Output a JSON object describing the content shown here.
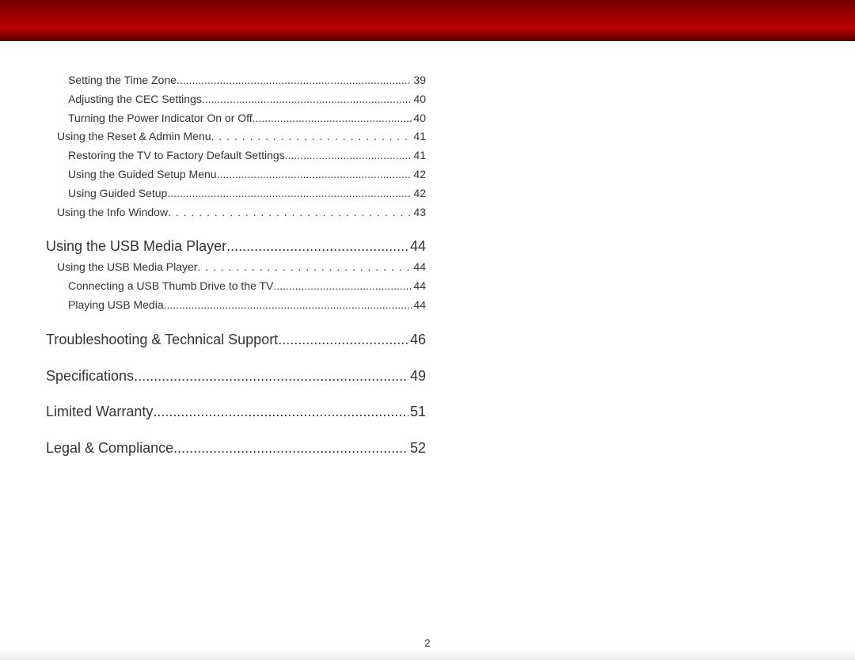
{
  "pageNumber": "2",
  "toc": [
    {
      "level": 2,
      "title": "Setting the Time Zone",
      "page": "39",
      "leader": "tight"
    },
    {
      "level": 2,
      "title": "Adjusting the CEC Settings",
      "page": "40",
      "leader": "tight"
    },
    {
      "level": 2,
      "title": "Turning the Power Indicator On or Off",
      "page": "40",
      "leader": "tight"
    },
    {
      "level": 1,
      "title": "Using the Reset & Admin Menu",
      "page": "41",
      "leader": "wide"
    },
    {
      "level": 2,
      "title": "Restoring the TV to Factory Default Settings",
      "page": "41",
      "leader": "tight"
    },
    {
      "level": 2,
      "title": "Using the Guided Setup Menu",
      "page": "42",
      "leader": "tight"
    },
    {
      "level": 2,
      "title": "Using Guided Setup",
      "page": "42",
      "leader": "tight"
    },
    {
      "level": 1,
      "title": "Using the Info Window",
      "page": "43",
      "leader": "wide"
    },
    {
      "level": 0,
      "title": "Using the USB Media Player",
      "page": "44",
      "leader": "tight"
    },
    {
      "level": 1,
      "title": "Using the USB Media Player",
      "page": "44",
      "leader": "wide"
    },
    {
      "level": 2,
      "title": "Connecting a USB Thumb Drive to the TV",
      "page": "44",
      "leader": "tight"
    },
    {
      "level": 2,
      "title": "Playing USB Media",
      "page": "44",
      "leader": "tight"
    },
    {
      "level": 0,
      "title": "Troubleshooting & Technical Support",
      "page": "46",
      "leader": "tight"
    },
    {
      "level": 0,
      "title": "Specifications",
      "page": "49",
      "leader": "tight"
    },
    {
      "level": 0,
      "title": "Limited Warranty",
      "page": "51",
      "leader": "tight"
    },
    {
      "level": 0,
      "title": "Legal & Compliance",
      "page": "52",
      "leader": "tight"
    }
  ]
}
